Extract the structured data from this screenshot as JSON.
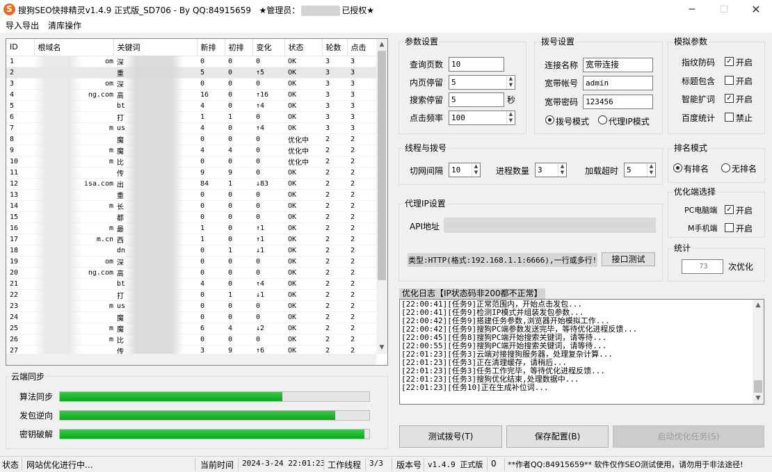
{
  "window": {
    "title": "搜狗SEO快排精灵v1.4.9 正式版_SD706 - By QQ:84915659",
    "admin_prefix": "★管理员：",
    "admin_suffix": "已授权★",
    "minimize_icon": "minimize-icon",
    "maximize_icon": "maximize-icon",
    "close_icon": "close-icon"
  },
  "menu": [
    "导入导出",
    "清库操作"
  ],
  "table": {
    "columns": [
      "ID",
      "根域名",
      "关键词",
      "新排",
      "初排",
      "变化",
      "状态",
      "轮数",
      "点击"
    ],
    "rows": [
      [
        "1",
        "om",
        "深",
        "0",
        "0",
        "0",
        "OK",
        "3",
        "3"
      ],
      [
        "2",
        "",
        "重",
        "5",
        "0",
        "↑5",
        "OK",
        "3",
        "3"
      ],
      [
        "3",
        "om",
        "深",
        "0",
        "0",
        "0",
        "OK",
        "3",
        "3"
      ],
      [
        "4",
        "ng.com",
        "高",
        "16",
        "0",
        "↑16",
        "OK",
        "3",
        "3"
      ],
      [
        "5",
        "",
        "bt",
        "4",
        "0",
        "↑4",
        "OK",
        "3",
        "3"
      ],
      [
        "6",
        "",
        "打",
        "1",
        "1",
        "0",
        "OK",
        "3",
        "3"
      ],
      [
        "7",
        "m",
        "us",
        "4",
        "0",
        "↑4",
        "OK",
        "3",
        "3"
      ],
      [
        "8",
        "",
        "魔",
        "0",
        "0",
        "0",
        "优化中",
        "2",
        "2"
      ],
      [
        "9",
        "m",
        "魔",
        "4",
        "4",
        "0",
        "优化中",
        "2",
        "2"
      ],
      [
        "10",
        "m",
        "比",
        "0",
        "0",
        "0",
        "优化中",
        "2",
        "2"
      ],
      [
        "11",
        "",
        "传",
        "9",
        "9",
        "0",
        "OK",
        "2",
        "2"
      ],
      [
        "12",
        "isa.com",
        "出",
        "84",
        "1",
        "↓83",
        "OK",
        "2",
        "2"
      ],
      [
        "13",
        "",
        "重",
        "0",
        "0",
        "0",
        "OK",
        "2",
        "2"
      ],
      [
        "14",
        "m",
        "长",
        "0",
        "0",
        "0",
        "OK",
        "2",
        "2"
      ],
      [
        "15",
        "",
        "都",
        "0",
        "0",
        "0",
        "OK",
        "2",
        "2"
      ],
      [
        "16",
        "m",
        "最",
        "1",
        "0",
        "↑1",
        "OK",
        "2",
        "2"
      ],
      [
        "17",
        "m.cn",
        "西",
        "1",
        "0",
        "↑1",
        "OK",
        "2",
        "2"
      ],
      [
        "18",
        "",
        "dn",
        "0",
        "1",
        "↓1",
        "OK",
        "2",
        "2"
      ],
      [
        "19",
        "om",
        "深",
        "0",
        "0",
        "0",
        "OK",
        "2",
        "2"
      ],
      [
        "20",
        "ng.com",
        "高",
        "0",
        "0",
        "0",
        "OK",
        "2",
        "2"
      ],
      [
        "21",
        "",
        "bt",
        "4",
        "0",
        "↑4",
        "OK",
        "2",
        "2"
      ],
      [
        "22",
        "",
        "打",
        "0",
        "1",
        "↓1",
        "OK",
        "2",
        "2"
      ],
      [
        "23",
        "m",
        "us",
        "0",
        "0",
        "0",
        "OK",
        "2",
        "2"
      ],
      [
        "24",
        "",
        "魔",
        "0",
        "0",
        "0",
        "OK",
        "2",
        "2"
      ],
      [
        "25",
        "m",
        "魔",
        "6",
        "4",
        "↓2",
        "OK",
        "2",
        "2"
      ],
      [
        "26",
        "m",
        "比",
        "0",
        "0",
        "0",
        "OK",
        "2",
        "2"
      ],
      [
        "27",
        "",
        "传",
        "3",
        "9",
        "↑6",
        "OK",
        "2",
        "2"
      ]
    ]
  },
  "params": {
    "title": "参数设置",
    "query_pages_label": "查询页数",
    "query_pages": "10",
    "inner_stay_label": "内页停留",
    "inner_stay": "5",
    "search_stay_label": "搜索停留",
    "search_stay": "5",
    "search_stay_unit": "秒",
    "click_freq_label": "点击频率",
    "click_freq": "100"
  },
  "dial": {
    "title": "拨号设置",
    "conn_name_label": "连接名称",
    "conn_name": "宽带连接",
    "account_label": "宽带帐号",
    "account": "admin",
    "password_label": "宽带密码",
    "password": "123456",
    "mode_dial": "拨号模式",
    "mode_proxy": "代理IP模式"
  },
  "sim": {
    "title": "模拟参数",
    "fingerprint_label": "指纹防码",
    "fingerprint": "开启",
    "title_contain_label": "标题包含",
    "title_contain": "开启",
    "smart_expand_label": "智能扩词",
    "smart_expand": "开启",
    "baidu_stats_label": "百度统计",
    "baidu_stats": "禁止"
  },
  "thread": {
    "title": "线程与拨号",
    "switch_interval_label": "切网间隔",
    "switch_interval": "10",
    "process_count_label": "进程数量",
    "process_count": "3",
    "load_timeout_label": "加载超时",
    "load_timeout": "5"
  },
  "rank_mode": {
    "title": "排名模式",
    "with_rank": "有排名",
    "no_rank": "无排名"
  },
  "proxy": {
    "title": "代理IP设置",
    "api_label": "API地址",
    "type_hint": "类型:HTTP(格式:192.168.1.1:6666),一行或多行!",
    "test_button": "接口测试"
  },
  "client": {
    "title": "优化端选择",
    "pc_label": "PC电脑端",
    "pc": "开启",
    "mobile_label": "M手机端",
    "mobile": "开启"
  },
  "stats": {
    "title": "统计",
    "count": "73",
    "unit": "次优化"
  },
  "log": {
    "title": "优化日志【IP状态码非200都不正常】",
    "lines": [
      "[22:00:41][任务9]正常范围内，开始点击发包...",
      "[22:00:41][任务9]检测IP模式并组装发包参数...",
      "[22:00:42][任务9]搭建任务参数,浏览器开始模拟工作...",
      "[22:00:42][任务9]搜狗PC端参数发送完毕，等待优化进程反馈...",
      "[22:00:45][任务8]搜狗PC端开始搜索关键词，请等待...",
      "[22:00:55][任务9]搜狗PC端开始搜索关键词，请等待...",
      "[22:01:23][任务3]云端对接搜狗服务器，处理复杂计算...",
      "[22:01:23][任务3]正在清理缓存，请稍后...",
      "[22:01:23][任务3]任务工作完毕，等待优化进程反馈...",
      "[22:01:23][任务3]搜狗优化结束,处理数据中...",
      "[22:01:23][任务10]正在生成补位词..."
    ]
  },
  "buttons": {
    "test_dial": "测试拨号(T)",
    "save_config": "保存配置(B)",
    "start_task": "启动优化任务(S)"
  },
  "cloud_sync": {
    "title": "云端同步",
    "bars": [
      {
        "label": "算法同步",
        "progress": 0.72
      },
      {
        "label": "发包逆向",
        "progress": 0.89
      },
      {
        "label": "密钥破解",
        "progress": 0.985
      }
    ]
  },
  "status": {
    "state_label": "状态",
    "state": "网站优化进行中...",
    "time_label": "当前时间",
    "time": "2024-3-24 22:01:23",
    "threads_label": "工作线程",
    "threads": "3/3",
    "version_label": "版本号",
    "version": "v1.4.9 正式版",
    "counter": "0",
    "notice": "**作者QQ:84915659** 软件仅作SEO测试使用，请勿用于非法途径!"
  },
  "colors": {
    "progress": "#06b025",
    "brand_icon": "#f26b1d"
  }
}
